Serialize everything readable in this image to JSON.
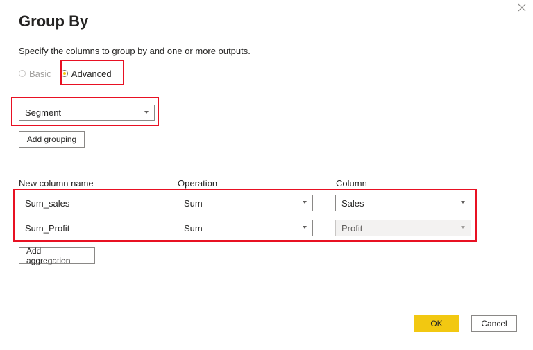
{
  "dialog": {
    "title": "Group By",
    "subtitle": "Specify the columns to group by and one or more outputs.",
    "close_icon": "close-icon"
  },
  "mode": {
    "basic_label": "Basic",
    "advanced_label": "Advanced",
    "selected": "Advanced"
  },
  "grouping": {
    "selected_column": "Segment",
    "add_grouping_label": "Add grouping"
  },
  "aggregations": {
    "headers": {
      "new_column_name": "New column name",
      "operation": "Operation",
      "column": "Column"
    },
    "rows": [
      {
        "name": "Sum_sales",
        "operation": "Sum",
        "column": "Sales"
      },
      {
        "name": "Sum_Profit",
        "operation": "Sum",
        "column": "Profit"
      }
    ],
    "add_aggregation_label": "Add aggregation"
  },
  "footer": {
    "ok_label": "OK",
    "cancel_label": "Cancel"
  },
  "colors": {
    "accent": "#f2c811",
    "highlight_box": "#e81123"
  }
}
